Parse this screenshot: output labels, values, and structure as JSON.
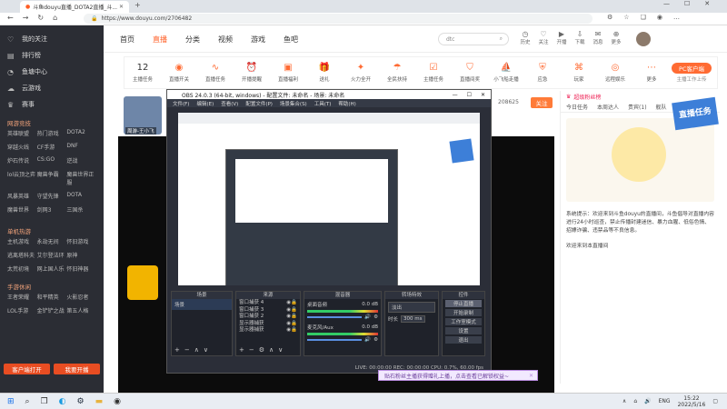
{
  "browser": {
    "tab_title": "斗鱼douyu直播_DOTA2直播_斗...",
    "url": "https://www.douyu.com/2706482"
  },
  "site": {
    "logo": "斗鱼",
    "nav": [
      "首页",
      "直播",
      "分类",
      "视频",
      "游戏",
      "鱼吧"
    ],
    "search_placeholder": "dtc",
    "header_icons": [
      "历史",
      "关注",
      "开播",
      "下载",
      "消息",
      "更多"
    ]
  },
  "sidebar": {
    "top_items": [
      {
        "label": "我的关注",
        "icon": "♡"
      },
      {
        "label": "排行榜",
        "icon": "▤"
      },
      {
        "label": "鱼塘中心",
        "icon": "◔"
      },
      {
        "label": "云游戏",
        "icon": "☁"
      },
      {
        "label": "赛事",
        "icon": "♛"
      }
    ],
    "sections": [
      {
        "title": "网游竞技",
        "items": [
          "英雄联盟",
          "热门游戏",
          "DOTA2",
          "穿越火线",
          "CF手游",
          "DNF",
          "炉石传说",
          "CS:GO",
          "逆战",
          "lol云顶之弈",
          "魔兽争霸",
          "魔兽世界正服",
          "风暴英雄",
          "守望先锋",
          "DOTA",
          "魔兽世界",
          "剑网3",
          "三国杀"
        ]
      },
      {
        "title": "单机热游",
        "items": [
          "主机游戏",
          "永劫无间",
          "怀旧游戏",
          "逃离塔科夫",
          "艾尔登法环",
          "原神",
          "太荒初境",
          "网上国人乐",
          "怀旧神器"
        ]
      },
      {
        "title": "手游休闲",
        "items": [
          "王者荣耀",
          "和平精英",
          "火影忍者",
          "LOL手游",
          "金铲铲之战",
          "第五人格"
        ]
      }
    ],
    "btn_client": "客户端打开",
    "btn_open": "我要开播"
  },
  "strip": {
    "count": "12",
    "count_label": "主播任务",
    "items": [
      "直播开关",
      "直播任务",
      "开播提醒",
      "直播福利",
      "送礼",
      "火力全开",
      "全民扶持",
      "主播任务",
      "直播间奖",
      "小飞船走播",
      "应急",
      "玩家",
      "远程娱乐",
      "更多"
    ],
    "pc_button": "PC客户端",
    "pc_sub": "主播工作上传"
  },
  "streamer": {
    "name": "周游-王小飞",
    "fans": "208625",
    "follow": "关注"
  },
  "obs": {
    "title": "OBS 24.0.3 (64-bit, windows) - 配置文件: 未命名 - 场景: 未命名",
    "menu": [
      "文件(F)",
      "编辑(E)",
      "查看(V)",
      "配置文件(P)",
      "场景集合(S)",
      "工具(T)",
      "帮助(H)"
    ],
    "panels": [
      "场景",
      "来源",
      "混音器",
      "转场特效",
      "控件"
    ],
    "scene": "场景",
    "sources": [
      "窗口捕获 4",
      "窗口捕获 3",
      "窗口捕获 2",
      "显示器捕获",
      "显示器捕获"
    ],
    "mixer": [
      {
        "name": "桌面音频",
        "db": "0.0 dB"
      },
      {
        "name": "麦克风/Aux",
        "db": "0.0 dB"
      }
    ],
    "transition": {
      "type": "淡出",
      "duration_label": "时长",
      "duration": "300 ms"
    },
    "controls": [
      "停止直播",
      "开始录制",
      "工作室模式",
      "设置",
      "退出"
    ],
    "status": "LIVE: 00:00:00   REC: 00:00:00   CPU: 0.7%, 60.00 fps"
  },
  "right": {
    "tabs": [
      "今日任务",
      "本周达人",
      "贵宾(1)",
      "舰队"
    ],
    "rank_title": "超级粉丝榜",
    "system_msg": "系统提示：欢迎来到斗鱼douyu的直播间，斗鱼倡导对直播内容进行24小时巡查，禁止传播封建迷信、暴力血腥、低俗色情、招嫖诈骗、违禁品等不良信息。",
    "welcome": "欢迎来到本直播间",
    "badge": "直播任务"
  },
  "notice": "贴石粉丝主播获得赠礼上播，点击查看已解锁权益~",
  "taskbar": {
    "time": "15:22",
    "date": "2022/5/16",
    "lang": "ENG"
  }
}
